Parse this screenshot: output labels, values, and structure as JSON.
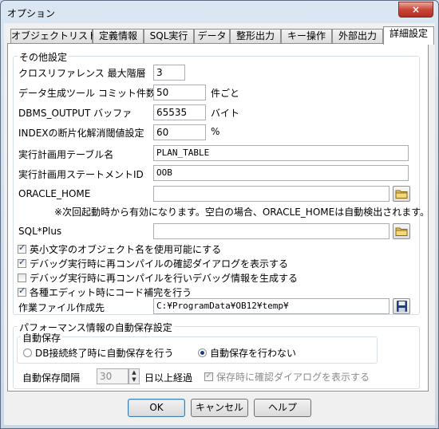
{
  "window": {
    "title": "オプション",
    "close_label": "×"
  },
  "tabs": [
    "オブジェクトリスト",
    "定義情報",
    "SQL実行",
    "データ",
    "整形出力",
    "キー操作",
    "外部出力",
    "詳細設定"
  ],
  "active_tab": "詳細設定",
  "other": {
    "title": "その他設定",
    "xref_label": "クロスリファレンス 最大階層",
    "xref_value": "3",
    "commit_label": "データ生成ツール コミット件数",
    "commit_value": "50",
    "commit_unit": "件ごと",
    "dbms_label": "DBMS_OUTPUT バッファ",
    "dbms_value": "65535",
    "dbms_unit": "バイト",
    "index_label": "INDEXの断片化解消閾値設定",
    "index_value": "60",
    "index_unit": "%",
    "plan_table_label": "実行計画用テーブル名",
    "plan_table_value": "PLAN_TABLE",
    "plan_stmt_label": "実行計画用ステートメントID",
    "plan_stmt_value": "OOB",
    "oracle_home_label": "ORACLE_HOME",
    "oracle_home_value": "",
    "oracle_home_note": "※次回起動時から有効になります。空白の場合、ORACLE_HOMEは自動検出されます。",
    "sqlplus_label": "SQL*Plus",
    "sqlplus_value": "",
    "cb1": "英小文字のオブジェクト名を使用可能にする",
    "cb2": "デバッグ実行時に再コンパイルの確認ダイアログを表示する",
    "cb3": "デバッグ実行時に再コンパイルを行いデバッグ情報を生成する",
    "cb4": "各種エディット時にコード補完を行う",
    "workdir_label": "作業ファイル作成先",
    "workdir_value": "C:¥ProgramData¥OB12¥temp¥"
  },
  "checks": {
    "cb1": true,
    "cb2": true,
    "cb3": false,
    "cb4": true
  },
  "perf": {
    "title": "パフォーマンス情報の自動保存設定",
    "autosave_title": "自動保存",
    "radio1": "DB接続終了時に自動保存を行う",
    "radio2": "自動保存を行わない",
    "interval_label": "自動保存間隔",
    "interval_value": "30",
    "interval_unit": "日以上経過",
    "confirm_label": "保存時に確認ダイアログを表示する"
  },
  "buttons": {
    "ok": "OK",
    "cancel": "キャンセル",
    "help": "ヘルプ"
  },
  "colors": {
    "accent": "#1d3d7a",
    "close": "#c8473a"
  }
}
